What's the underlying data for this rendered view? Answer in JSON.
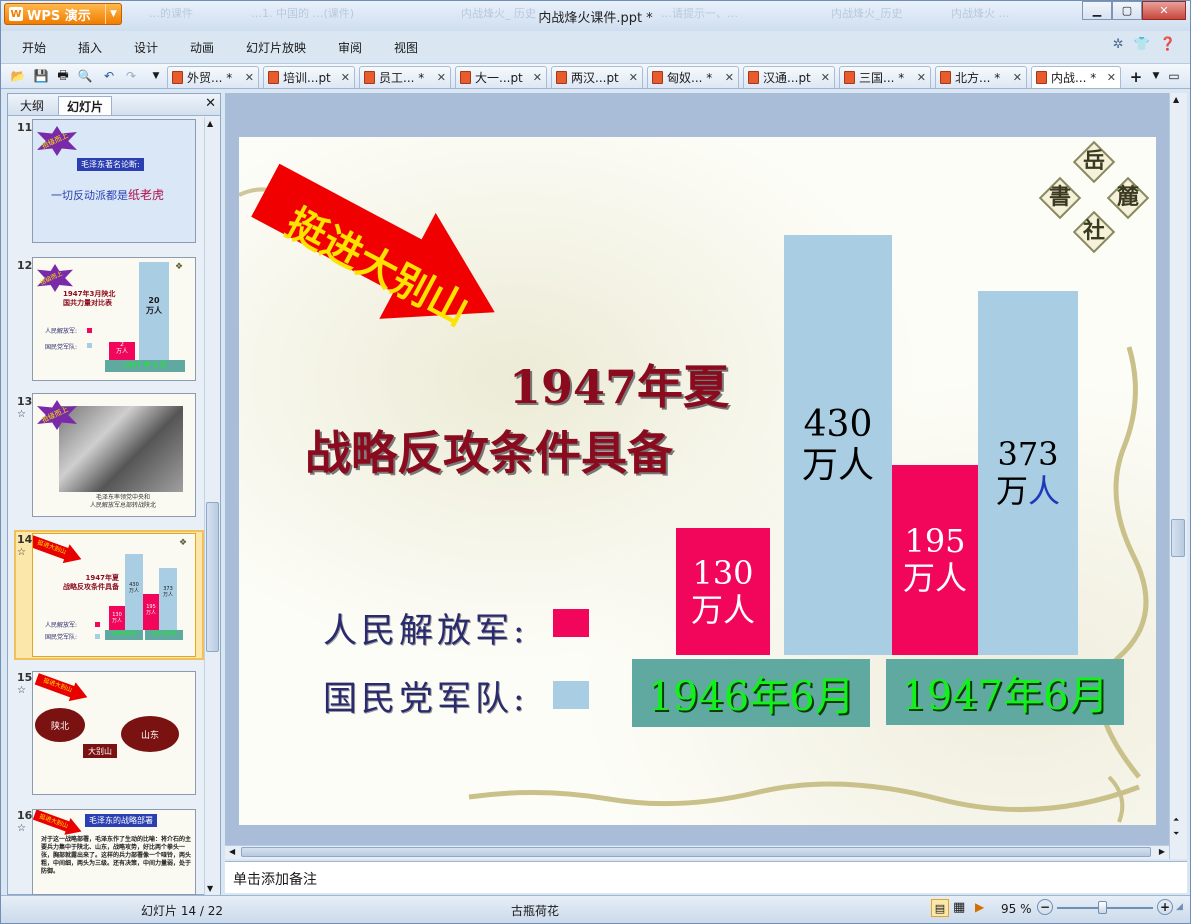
{
  "app": {
    "button_label": "WPS 演示",
    "window_title": "内战烽火课件.ppt *",
    "bg_tabs": [
      "…的课件",
      "…1. 中国的 …(课件)",
      "内战烽火_ 历史",
      "…请提示一、…",
      "内战烽火_历史",
      "内战烽火 …"
    ]
  },
  "menu": {
    "items": [
      "开始",
      "插入",
      "设计",
      "动画",
      "幻灯片放映",
      "审阅",
      "视图"
    ]
  },
  "doc_tabs": [
    {
      "label": "外贸... *",
      "active": false
    },
    {
      "label": "培训...pt",
      "active": false
    },
    {
      "label": "员工... *",
      "active": false
    },
    {
      "label": "大一...pt",
      "active": false
    },
    {
      "label": "两汉...pt",
      "active": false
    },
    {
      "label": "匈奴... *",
      "active": false
    },
    {
      "label": "汉通...pt",
      "active": false
    },
    {
      "label": "三国... *",
      "active": false
    },
    {
      "label": "北方... *",
      "active": false
    },
    {
      "label": "内战... *",
      "active": true
    }
  ],
  "panel": {
    "tab_outline": "大纲",
    "tab_slides": "幻灯片"
  },
  "thumbnails": [
    {
      "num": "11",
      "star": "",
      "badge": "拾级而上",
      "heading": "毛泽东著名论断:",
      "body": "一切反动派都是",
      "highlight": "纸老虎"
    },
    {
      "num": "12",
      "star": "",
      "badge": "拾级而上",
      "title": "1947年3月陕北\n国共力量对比表",
      "legend_a": "人民解放军:",
      "legend_b": "国民党军队:",
      "bar_a": "2\n万人",
      "bar_b": "20\n万人",
      "axis": "1947 年 3 月"
    },
    {
      "num": "13",
      "star": "☆",
      "badge": "拾级而上",
      "caption": "毛泽东率领党中央和\n人民解放军总部转战陕北"
    },
    {
      "num": "14",
      "star": "☆",
      "arrow": "挺进大别山",
      "title": "1947年夏\n战略反攻条件具备",
      "legend_a": "人民解放军:",
      "legend_b": "国民党军队:",
      "bars": [
        "130\n万人",
        "430\n万人",
        "195\n万人",
        "373\n万人"
      ],
      "years": [
        "1946年6月",
        "1947年6月"
      ]
    },
    {
      "num": "15",
      "star": "☆",
      "arrow": "挺进大别山",
      "left": "陕北",
      "right": "山东",
      "center": "大别山"
    },
    {
      "num": "16",
      "star": "☆",
      "arrow": "挺进大别山",
      "heading": "毛泽东的战略部署",
      "body": "对于这一战略部署，毛泽东作了生动的比喻：将介石的主要兵力集中于陕北、山东，战略攻势，好比两个拳头一张，胸部就露出来了。这样的兵力部署像一个哑铃，两头粗，中间细，两头为三级。还有决策，中间力量弱，处于防御。"
    }
  ],
  "slide": {
    "arrow_text": "挺进大别山",
    "title_line1": "1947年夏",
    "title_line2": "战略反攻条件具备",
    "seal_chars": [
      "岳",
      "麓",
      "書",
      "社"
    ],
    "legend": [
      {
        "label": "人民解放军:",
        "color": "#f2065c"
      },
      {
        "label": "国民党军队:",
        "color": "#a9cde3"
      }
    ],
    "bars": [
      {
        "value": "130",
        "unit": "万人",
        "color": "#f2065c",
        "text_color": "#ffffff"
      },
      {
        "value": "430",
        "unit": "万人",
        "color": "#a9cde3",
        "text_color": "#000000"
      },
      {
        "value": "195",
        "unit": "万人",
        "color": "#f2065c",
        "text_color": "#ffffff"
      },
      {
        "value": "373",
        "unit": "万",
        "unit_tail": "人",
        "color": "#a9cde3",
        "text_color": "#000000"
      }
    ],
    "years": [
      "1946年6月",
      "1947年6月"
    ]
  },
  "notes": {
    "placeholder": "单击添加备注"
  },
  "status": {
    "slide_counter": "幻灯片 14 / 22",
    "theme": "古瓶荷花",
    "zoom": "95 %",
    "zoom_level": 0.95
  }
}
